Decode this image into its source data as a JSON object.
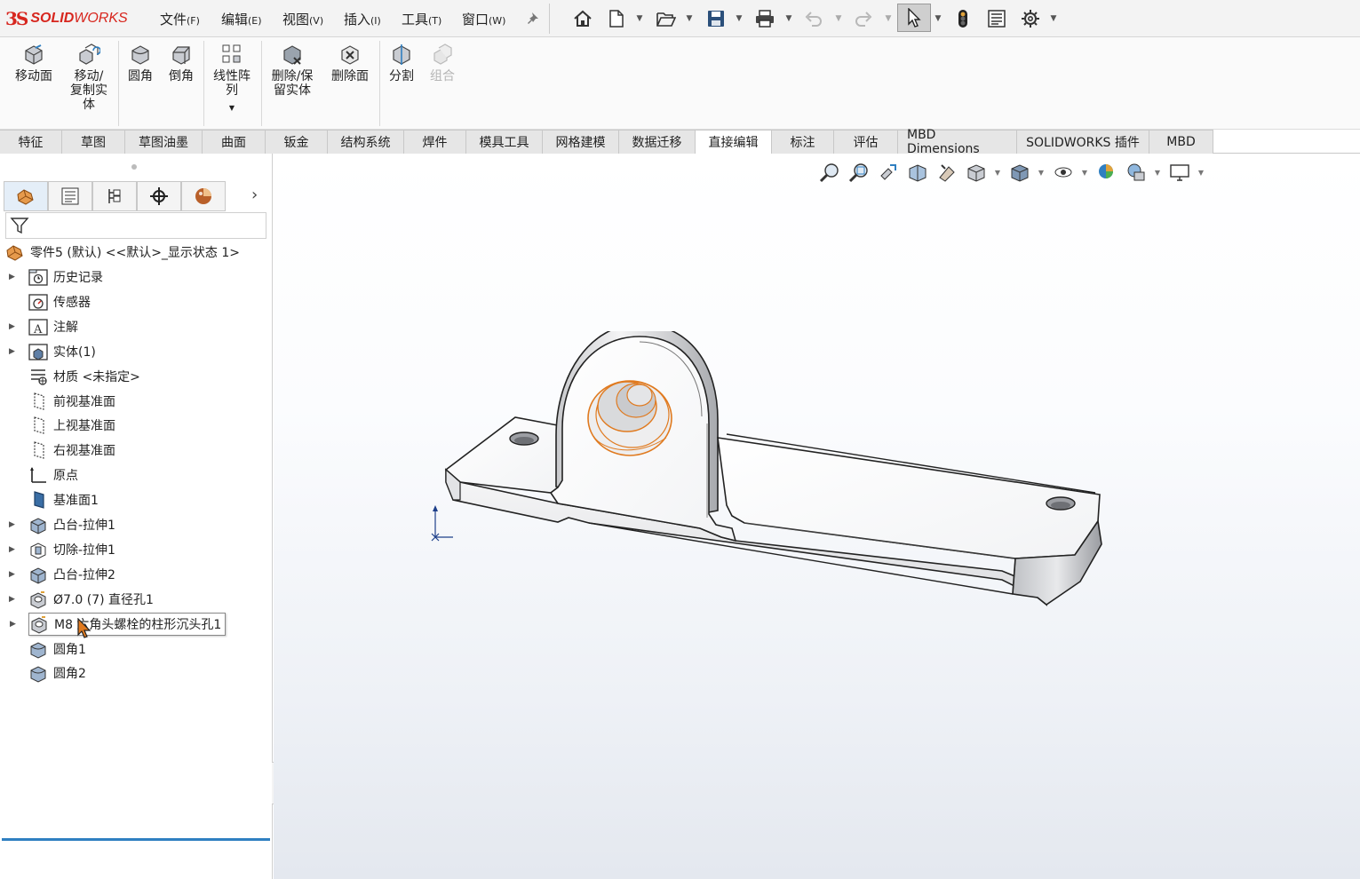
{
  "app": {
    "logo_ds": "3S",
    "logo_name_bold": "SOLID",
    "logo_name_rest": "WORKS"
  },
  "menu": [
    {
      "label": "文件",
      "key": "(F)"
    },
    {
      "label": "编辑",
      "key": "(E)"
    },
    {
      "label": "视图",
      "key": "(V)"
    },
    {
      "label": "插入",
      "key": "(I)"
    },
    {
      "label": "工具",
      "key": "(T)"
    },
    {
      "label": "窗口",
      "key": "(W)"
    }
  ],
  "ribbon": [
    {
      "label": "移动面",
      "icon": "move-face-icon"
    },
    {
      "label": "移动/\n复制实\n体",
      "icon": "move-copy-body-icon"
    },
    {
      "label": "圆角",
      "icon": "fillet-icon"
    },
    {
      "label": "倒角",
      "icon": "chamfer-icon"
    },
    {
      "label": "线性阵\n列",
      "icon": "linear-pattern-icon"
    },
    {
      "label": "删除/保\n留实体",
      "icon": "delete-keep-body-icon"
    },
    {
      "label": "删除面",
      "icon": "delete-face-icon"
    },
    {
      "label": "分割",
      "icon": "split-icon"
    },
    {
      "label": "组合",
      "icon": "combine-icon",
      "disabled": true
    }
  ],
  "tabs": [
    "特征",
    "草图",
    "草图油墨",
    "曲面",
    "钣金",
    "结构系统",
    "焊件",
    "模具工具",
    "网格建模",
    "数据迁移",
    "直接编辑",
    "标注",
    "评估",
    "MBD Dimensions",
    "SOLIDWORKS 插件",
    "MBD"
  ],
  "active_tab": "直接编辑",
  "tree": {
    "root": "零件5 (默认) <<默认>_显示状态 1>",
    "items": [
      {
        "label": "历史记录",
        "icon": "history-folder-icon",
        "expandable": true
      },
      {
        "label": "传感器",
        "icon": "sensors-folder-icon",
        "expandable": false
      },
      {
        "label": "注解",
        "icon": "annotations-folder-icon",
        "expandable": true
      },
      {
        "label": "实体(1)",
        "icon": "solid-bodies-folder-icon",
        "expandable": true
      },
      {
        "label": "材质 <未指定>",
        "icon": "material-icon",
        "expandable": false
      },
      {
        "label": "前视基准面",
        "icon": "plane-icon",
        "expandable": false
      },
      {
        "label": "上视基准面",
        "icon": "plane-icon",
        "expandable": false
      },
      {
        "label": "右视基准面",
        "icon": "plane-icon",
        "expandable": false
      },
      {
        "label": "原点",
        "icon": "origin-icon",
        "expandable": false
      },
      {
        "label": "基准面1",
        "icon": "plane-filled-icon",
        "expandable": false
      },
      {
        "label": "凸台-拉伸1",
        "icon": "boss-extrude-icon",
        "expandable": true
      },
      {
        "label": "切除-拉伸1",
        "icon": "cut-extrude-icon",
        "expandable": true
      },
      {
        "label": "凸台-拉伸2",
        "icon": "boss-extrude-icon",
        "expandable": true
      },
      {
        "label": "Ø7.0 (7) 直径孔1",
        "icon": "hole-wizard-icon",
        "expandable": true
      },
      {
        "label": "M8 六角头螺栓的柱形沉头孔1",
        "icon": "hole-wizard-icon",
        "expandable": true,
        "hover": true
      },
      {
        "label": "圆角1",
        "icon": "fillet-feature-icon",
        "expandable": false
      },
      {
        "label": "圆角2",
        "icon": "fillet-feature-icon",
        "expandable": false
      }
    ]
  },
  "colors": {
    "accent": "#2f7fc1",
    "brand": "#d7261e",
    "selection": "#e07a1f"
  }
}
